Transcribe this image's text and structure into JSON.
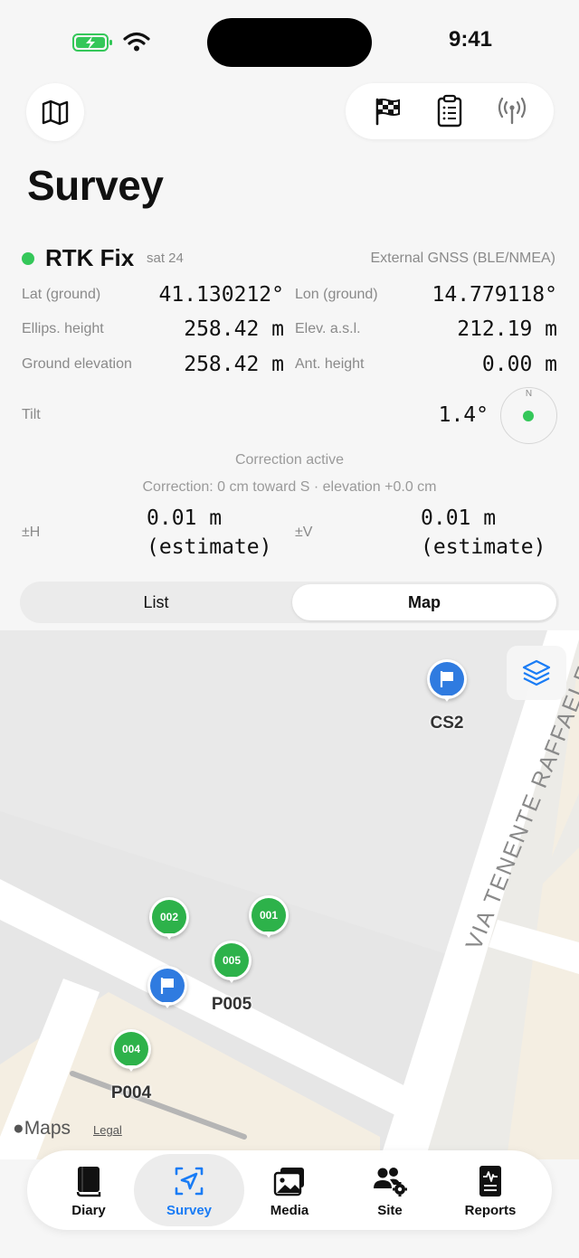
{
  "status_bar": {
    "time": "9:41"
  },
  "page": {
    "title": "Survey"
  },
  "fix": {
    "label": "RTK Fix",
    "sat": "sat 24",
    "source": "External GNSS (BLE/NMEA)"
  },
  "readings": {
    "lat_label": "Lat (ground)",
    "lat_value": "41.130212°",
    "lon_label": "Lon (ground)",
    "lon_value": "14.779118°",
    "ellips_label": "Ellips. height",
    "ellips_value": "258.42 m",
    "elev_label": "Elev. a.s.l.",
    "elev_value": "212.19 m",
    "ground_label": "Ground elevation",
    "ground_value": "258.42 m",
    "ant_label": "Ant. height",
    "ant_value": "0.00 m",
    "tilt_label": "Tilt",
    "tilt_value": "1.4°",
    "compass_n": "N"
  },
  "correction": {
    "status": "Correction active",
    "detail": "Correction: 0 cm toward S · elevation +0.0 cm"
  },
  "accuracy": {
    "h_label": "±H",
    "h_value": "0.01 m",
    "h_note": "(estimate)",
    "v_label": "±V",
    "v_value": "0.01 m",
    "v_note": "(estimate)"
  },
  "segmented": {
    "list": "List",
    "map": "Map",
    "selected": "Map"
  },
  "map": {
    "street": "VIA TENENTE RAFFAELE",
    "attribution": "Maps",
    "legal": "Legal",
    "points": [
      {
        "id": "cs2",
        "kind": "flag",
        "caption": "CS2"
      },
      {
        "id": "002",
        "kind": "point",
        "label": "002"
      },
      {
        "id": "001",
        "kind": "point",
        "label": "001"
      },
      {
        "id": "005",
        "kind": "point",
        "label": "005",
        "caption": "P005"
      },
      {
        "id": "flag2",
        "kind": "flag"
      },
      {
        "id": "004",
        "kind": "point",
        "label": "004",
        "caption": "P004"
      }
    ]
  },
  "tabs": [
    {
      "label": "Diary",
      "icon": "book-icon"
    },
    {
      "label": "Survey",
      "icon": "location-arrow-icon",
      "active": true
    },
    {
      "label": "Media",
      "icon": "photos-icon"
    },
    {
      "label": "Site",
      "icon": "people-gear-icon"
    },
    {
      "label": "Reports",
      "icon": "report-icon"
    }
  ],
  "colors": {
    "accent": "#1a7cf5",
    "fix_green": "#34c759",
    "point_green": "#2db24a",
    "flag_blue": "#2f7be0"
  }
}
